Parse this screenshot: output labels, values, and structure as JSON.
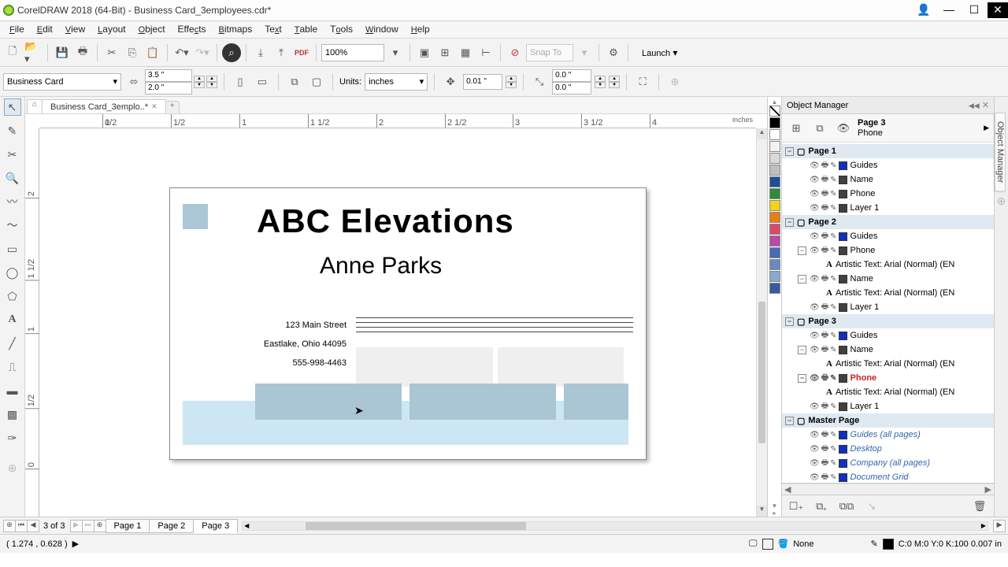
{
  "app": {
    "title": "CorelDRAW 2018 (64-Bit) - Business Card_3employees.cdr*"
  },
  "menu": {
    "file": "File",
    "edit": "Edit",
    "view": "View",
    "layout": "Layout",
    "object": "Object",
    "effects": "Effects",
    "bitmaps": "Bitmaps",
    "text": "Text",
    "table": "Table",
    "tools": "Tools",
    "window": "Window",
    "help": "Help"
  },
  "tb1": {
    "zoom": "100%",
    "snap": "Snap To",
    "launch": "Launch"
  },
  "tb2": {
    "preset": "Business Card",
    "w": "3.5 \"",
    "h": "2.0 \"",
    "units_label": "Units:",
    "units": "inches",
    "nudge": "0.01 \"",
    "dupx": "0.0 \"",
    "dupy": "0.0 \""
  },
  "doc": {
    "tab": "Business Card_3emplo..*",
    "ruler_unit": "inches"
  },
  "ruler": {
    "ticks": [
      "0",
      "1/2",
      "1",
      "1 1/2",
      "2",
      "2 1/2",
      "3",
      "3 1/2",
      "4"
    ],
    "lefthalf": "1/2",
    "lefthalf2": "1/2"
  },
  "card": {
    "company": "ABC Elevations",
    "name": "Anne Parks",
    "addr1": "123 Main Street",
    "addr2": "Eastlake, Ohio 44095",
    "phone": "555-998-4463"
  },
  "objmgr": {
    "title": "Object Manager",
    "cur_page": "Page 3",
    "cur_layer": "Phone",
    "pages": [
      {
        "name": "Page 1",
        "layers": [
          {
            "n": "Guides",
            "c": "#1030c0",
            "i": true
          },
          {
            "n": "Name",
            "c": "#404040"
          },
          {
            "n": "Phone",
            "c": "#404040"
          },
          {
            "n": "Layer 1",
            "c": "#404040"
          }
        ]
      },
      {
        "name": "Page 2",
        "layers": [
          {
            "n": "Guides",
            "c": "#1030c0",
            "i": true
          },
          {
            "n": "Phone",
            "c": "#404040",
            "children": [
              "Artistic Text: Arial (Normal) (EN"
            ]
          },
          {
            "n": "Name",
            "c": "#404040",
            "children": [
              "Artistic Text: Arial (Normal) (EN"
            ]
          },
          {
            "n": "Layer 1",
            "c": "#404040"
          }
        ]
      },
      {
        "name": "Page 3",
        "layers": [
          {
            "n": "Guides",
            "c": "#1030c0",
            "i": true
          },
          {
            "n": "Name",
            "c": "#404040",
            "children": [
              "Artistic Text: Arial (Normal) (EN"
            ]
          },
          {
            "n": "Phone",
            "c": "#404040",
            "sel": true,
            "children": [
              "Artistic Text: Arial (Normal) (EN"
            ]
          },
          {
            "n": "Layer 1",
            "c": "#404040"
          }
        ]
      },
      {
        "name": "Master Page",
        "master": true,
        "layers": [
          {
            "n": "Guides (all pages)",
            "c": "#1030c0",
            "i": true,
            "it": true
          },
          {
            "n": "Desktop",
            "c": "#1030c0",
            "it": true
          },
          {
            "n": "Company (all pages)",
            "c": "#1030c0",
            "it": true
          },
          {
            "n": "Document Grid",
            "c": "#1030c0",
            "it": true
          }
        ]
      }
    ]
  },
  "palette_colors": [
    "#000000",
    "#ffffff",
    "#f2f2f2",
    "#d9d9d9",
    "#bfbfbf",
    "#1f4e9c",
    "#2e8b3d",
    "#f2d21f",
    "#e87d1a",
    "#d94a6a",
    "#b84aa8",
    "#4a6ab8",
    "#6a8abf",
    "#8aa8cf",
    "#3a5a9f"
  ],
  "pagenav": {
    "count": "3 of 3",
    "pages": [
      "Page 1",
      "Page 2",
      "Page 3"
    ],
    "active": 2
  },
  "status": {
    "coords": "( 1.274 , 0.628 )",
    "arrow": "▶",
    "fill": "None",
    "outline": "C:0 M:0 Y:0 K:100 0.007 in"
  },
  "vtab": {
    "label": "Object Manager"
  }
}
